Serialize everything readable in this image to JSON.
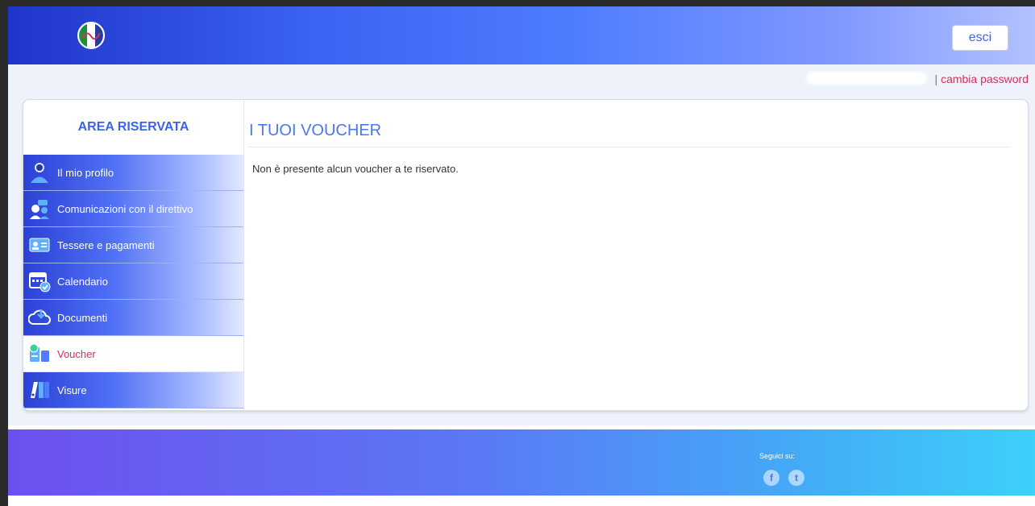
{
  "header": {
    "logo_icon": "italian-flag-emblem-icon",
    "logout_label": "esci"
  },
  "account": {
    "separator": "|",
    "change_password_label": "cambia password"
  },
  "sidebar": {
    "title": "AREA RISERVATA",
    "items": [
      {
        "label": "Il mio profilo",
        "icon": "user-profile-icon"
      },
      {
        "label": "Comunicazioni con il direttivo",
        "icon": "chat-people-icon"
      },
      {
        "label": "Tessere e pagamenti",
        "icon": "id-card-icon"
      },
      {
        "label": "Calendario",
        "icon": "calendar-icon"
      },
      {
        "label": "Documenti",
        "icon": "cloud-download-icon"
      },
      {
        "label": "Voucher",
        "icon": "voucher-icon",
        "active": true
      },
      {
        "label": "Visure",
        "icon": "binders-icon"
      }
    ]
  },
  "main": {
    "title": "I TUOI VOUCHER",
    "message": "Non è presente alcun voucher a te riservato."
  },
  "footer": {
    "follow_label": "Seguici su:",
    "social": [
      {
        "glyph": "f",
        "icon": "facebook-icon"
      },
      {
        "glyph": "t",
        "icon": "twitter-icon"
      }
    ]
  },
  "colors": {
    "accent_blue": "#3d63e8",
    "active_pink": "#d4305a"
  }
}
